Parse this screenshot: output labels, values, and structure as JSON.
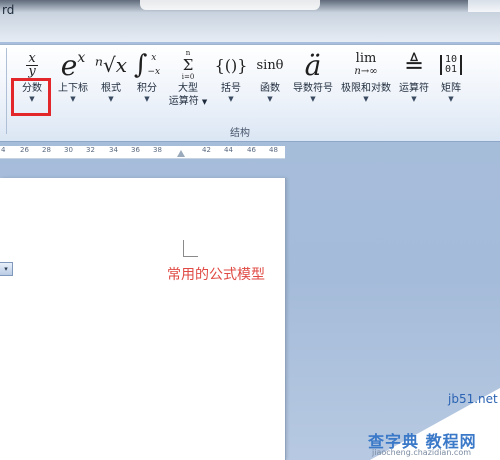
{
  "window": {
    "title": "rd"
  },
  "ribbon": {
    "buttons": [
      {
        "id": "fraction",
        "icon": "fraction-icon",
        "glyph_top": "x",
        "glyph_bottom": "y",
        "label": "分数",
        "label2": ""
      },
      {
        "id": "script",
        "icon": "superscript-icon",
        "glyph": "e",
        "glyph_sup": "x",
        "label": "上下标",
        "label2": ""
      },
      {
        "id": "radical",
        "icon": "radical-icon",
        "glyph": "ⁿ√x",
        "label": "根式",
        "label2": ""
      },
      {
        "id": "integral",
        "icon": "integral-icon",
        "glyph": "∫",
        "glyph_upper": "x",
        "glyph_lower": "−x",
        "label": "积分",
        "label2": ""
      },
      {
        "id": "large-operator",
        "icon": "summation-icon",
        "glyph": "Σ",
        "glyph_upper": "n",
        "glyph_lower": "i=0",
        "label": "大型",
        "label2": "运算符"
      },
      {
        "id": "bracket",
        "icon": "bracket-icon",
        "glyph": "{()}",
        "label": "括号",
        "label2": ""
      },
      {
        "id": "function",
        "icon": "function-icon",
        "glyph": "sinθ",
        "label": "函数",
        "label2": ""
      },
      {
        "id": "accent",
        "icon": "accent-icon",
        "glyph": "ä",
        "label": "导数符号",
        "label2": ""
      },
      {
        "id": "limit-log",
        "icon": "limit-icon",
        "glyph": "lim",
        "glyph_lower": "n→∞",
        "label": "极限和对数",
        "label2": ""
      },
      {
        "id": "operator",
        "icon": "operator-icon",
        "glyph": "≜",
        "label": "运算符",
        "label2": ""
      },
      {
        "id": "matrix",
        "icon": "matrix-icon",
        "glyph": "10\n01",
        "label": "矩阵",
        "label2": ""
      }
    ],
    "group_label": "结构"
  },
  "ruler": {
    "ticks": [
      "4",
      "26",
      "28",
      "30",
      "32",
      "34",
      "36",
      "38",
      "42",
      "44",
      "46",
      "48"
    ]
  },
  "document": {
    "caption": "常用的公式模型",
    "dropdown_glyph": "▾"
  },
  "watermark": {
    "url": "jb51.net",
    "brand": "查字典 教程网",
    "sub": "jiaocheng.chazidian.com"
  },
  "colors": {
    "highlight": "#e3262a",
    "caption": "#e04a44",
    "ribbon_bg": "#eef3fa",
    "workspace_bg": "#a9bfdc"
  }
}
